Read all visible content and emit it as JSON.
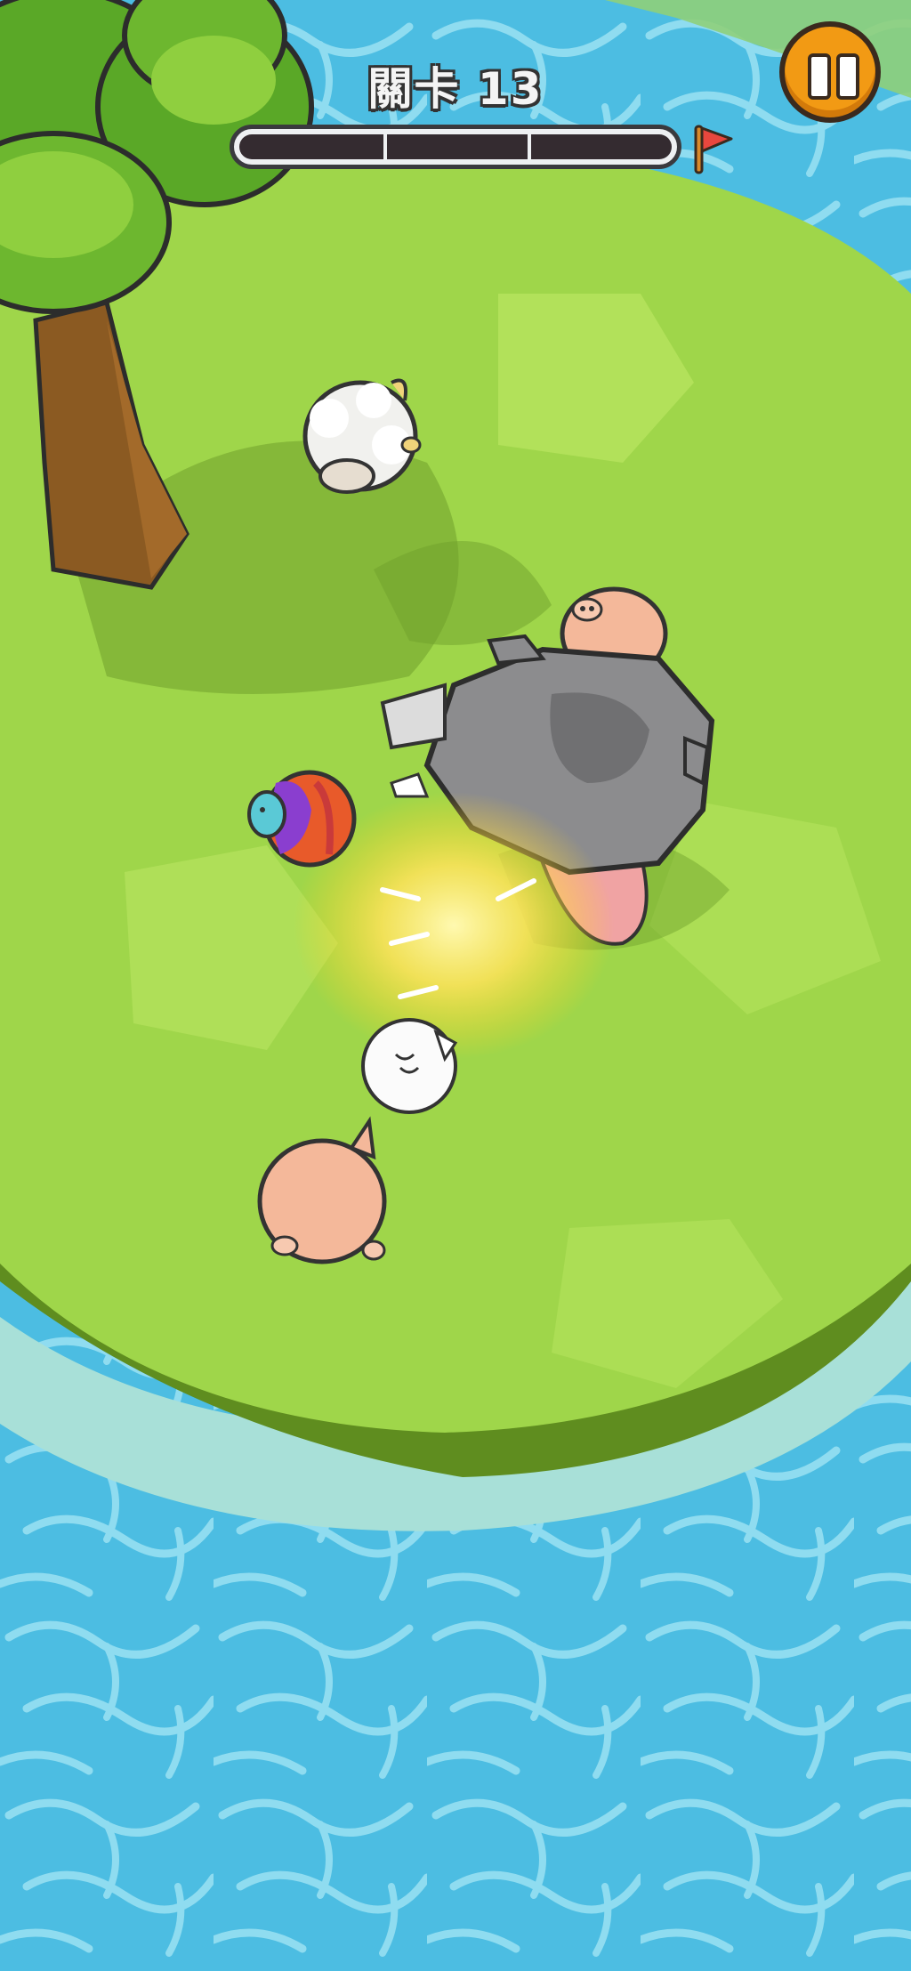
{
  "hud": {
    "level_label": "關卡 13",
    "progress_fraction": 0.0,
    "progress_segments": 3,
    "flag_icon": "goal-flag-icon",
    "pause_icon": "pause-icon"
  },
  "scene": {
    "island_color": "#9fd64a",
    "water_color": "#4dbde0",
    "characters": [
      "sheep",
      "pig",
      "rhino-boss",
      "rainbow-shell-creature",
      "white-cat",
      "pig"
    ]
  },
  "colors": {
    "accent": "#f29a14",
    "flag": "#e8473e"
  }
}
